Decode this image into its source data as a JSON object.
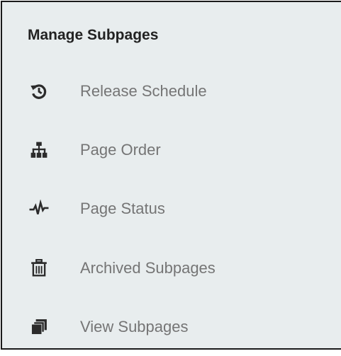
{
  "panel": {
    "title": "Manage Subpages",
    "items": [
      {
        "label": "Release Schedule",
        "icon": "history-icon"
      },
      {
        "label": "Page Order",
        "icon": "sitemap-icon"
      },
      {
        "label": "Page Status",
        "icon": "heartbeat-icon"
      },
      {
        "label": "Archived Subpages",
        "icon": "trash-icon"
      },
      {
        "label": "View Subpages",
        "icon": "copy-icon"
      }
    ]
  },
  "colors": {
    "background": "#e8edee",
    "title": "#222222",
    "label": "#757575",
    "icon": "#2b2b2b",
    "border": "#1a1a1a"
  }
}
